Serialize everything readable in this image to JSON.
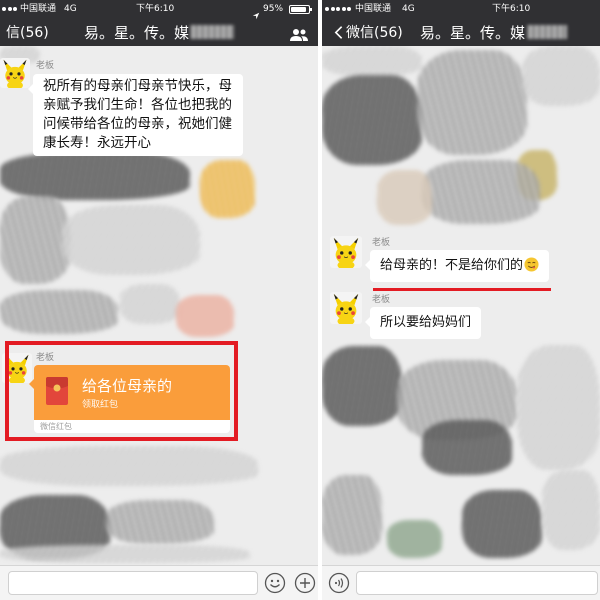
{
  "left": {
    "status_bar": {
      "carrier": "中国联通",
      "network": "4G",
      "time": "下午6:10",
      "battery": "95%"
    },
    "header": {
      "back_label": "信(56)",
      "title": "易。星。传。媒",
      "members_icon": "group-members-icon"
    },
    "messages": [
      {
        "sender": "老板",
        "text": "祝所有的母亲们母亲节快乐，母亲赋予我们生命！各位也把我的问候带给各位的母亲，祝她们健康长寿！永远开心"
      }
    ],
    "red_packet": {
      "sender": "老板",
      "title": "给各位母亲的",
      "action": "领取红包",
      "footer": "微信红包",
      "icon": "red-packet-icon"
    },
    "input_bar": {
      "emoji_icon": "smiley-icon",
      "more_icon": "plus-circle-icon"
    }
  },
  "right": {
    "status_bar": {
      "carrier": "中国联通",
      "network": "4G",
      "time": "下午6:10"
    },
    "header": {
      "back_icon": "chevron-left-icon",
      "back_label": "微信(56)",
      "title": "易。星。传。媒"
    },
    "messages": [
      {
        "sender": "老板",
        "text": "给母亲的！不是给你们的",
        "emoji": "yum-face-emoji-icon"
      },
      {
        "sender": "老板",
        "text": "所以要给妈妈们"
      }
    ],
    "input_bar": {
      "voice_icon": "voice-input-icon"
    }
  },
  "colors": {
    "header_bg": "#303033",
    "chat_bg": "#ededed",
    "bubble_bg": "#ffffff",
    "red_packet_orange": "#fa9d3b",
    "highlight_red": "#e31b23"
  }
}
